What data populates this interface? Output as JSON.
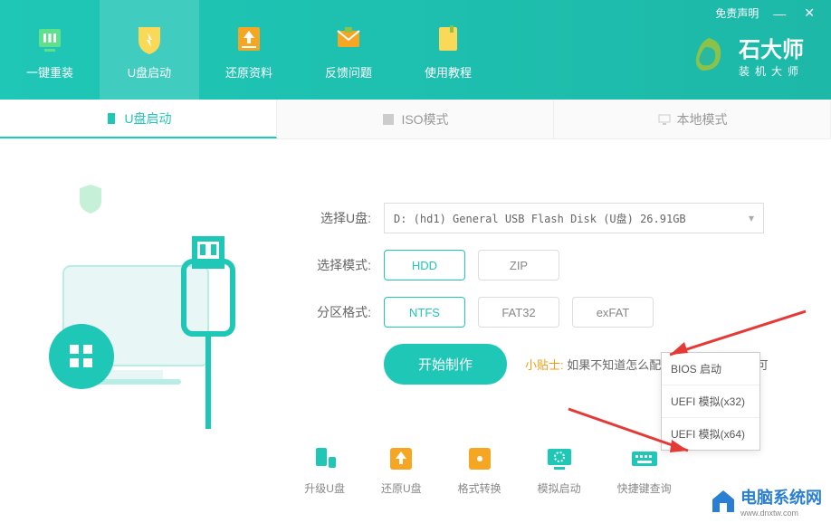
{
  "header": {
    "disclaimer": "免责声明",
    "tabs": [
      {
        "label": "一键重装",
        "icon": "bars"
      },
      {
        "label": "U盘启动",
        "icon": "shield",
        "active": true
      },
      {
        "label": "还原资料",
        "icon": "upload"
      },
      {
        "label": "反馈问题",
        "icon": "mail"
      },
      {
        "label": "使用教程",
        "icon": "book"
      }
    ],
    "logo": {
      "title": "石大师",
      "sub": "装机大师"
    }
  },
  "sub_tabs": [
    {
      "label": "U盘启动",
      "active": true
    },
    {
      "label": "ISO模式"
    },
    {
      "label": "本地模式"
    }
  ],
  "form": {
    "usb": {
      "label": "选择U盘:",
      "value": "D: (hd1) General USB Flash Disk (U盘) 26.91GB"
    },
    "mode": {
      "label": "选择模式:",
      "options": [
        "HDD",
        "ZIP"
      ],
      "selected": "HDD"
    },
    "partition": {
      "label": "分区格式:",
      "options": [
        "NTFS",
        "FAT32",
        "exFAT"
      ],
      "selected": "NTFS"
    },
    "start_button": "开始制作",
    "tip_label": "小贴士:",
    "tip_text": "如果不知道怎么配置",
    "tip_suffix": "即可"
  },
  "bios_menu": {
    "items": [
      "BIOS 启动",
      "UEFI 模拟(x32)",
      "UEFI 模拟(x64)"
    ]
  },
  "bottom_tools": [
    {
      "label": "升级U盘",
      "color": "#1fc7b6"
    },
    {
      "label": "还原U盘",
      "color": "#f5a623"
    },
    {
      "label": "格式转换",
      "color": "#f5a623"
    },
    {
      "label": "模拟启动",
      "color": "#1fc7b6"
    },
    {
      "label": "快捷键查询",
      "color": "#1fc7b6"
    }
  ],
  "watermark": {
    "title": "电脑系统网",
    "url": "www.dnxtw.com"
  }
}
